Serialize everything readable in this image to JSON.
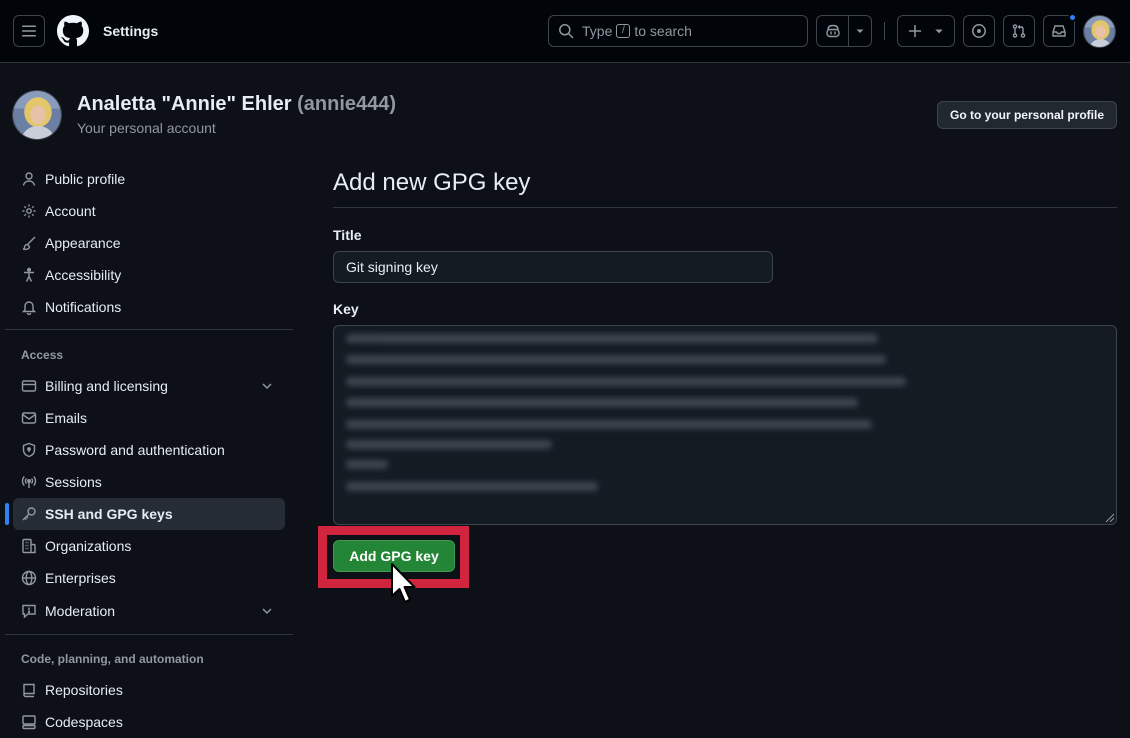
{
  "header": {
    "context_title": "Settings",
    "search": {
      "prefix": "Type",
      "kbd": "/",
      "suffix": "to search"
    }
  },
  "profile": {
    "display_name": "Analetta \"Annie\" Ehler",
    "login": "(annie444)",
    "subtitle": "Your personal account",
    "profile_button": "Go to your personal profile"
  },
  "sidebar": {
    "items": [
      {
        "label": "Public profile",
        "icon": "person-icon"
      },
      {
        "label": "Account",
        "icon": "gear-icon"
      },
      {
        "label": "Appearance",
        "icon": "paintbrush-icon"
      },
      {
        "label": "Accessibility",
        "icon": "accessibility-icon"
      },
      {
        "label": "Notifications",
        "icon": "bell-icon"
      }
    ],
    "access_heading": "Access",
    "access_items": [
      {
        "label": "Billing and licensing",
        "icon": "credit-card-icon"
      },
      {
        "label": "Emails",
        "icon": "mail-icon"
      },
      {
        "label": "Password and authentication",
        "icon": "shield-lock-icon"
      },
      {
        "label": "Sessions",
        "icon": "broadcast-icon"
      },
      {
        "label": "SSH and GPG keys",
        "icon": "key-icon",
        "active": true
      },
      {
        "label": "Organizations",
        "icon": "organization-icon"
      },
      {
        "label": "Enterprises",
        "icon": "globe-icon"
      },
      {
        "label": "Moderation",
        "icon": "report-icon"
      }
    ],
    "code_heading": "Code, planning, and automation",
    "code_items": [
      {
        "label": "Repositories",
        "icon": "repo-icon"
      },
      {
        "label": "Codespaces",
        "icon": "codespaces-icon"
      }
    ]
  },
  "main": {
    "page_title": "Add new GPG key",
    "title_label": "Title",
    "title_value": "Git signing key",
    "key_label": "Key",
    "submit_label": "Add GPG key"
  },
  "colors": {
    "accent": "#2f81f7",
    "primary_button": "#238636",
    "highlight": "#d1243f"
  }
}
